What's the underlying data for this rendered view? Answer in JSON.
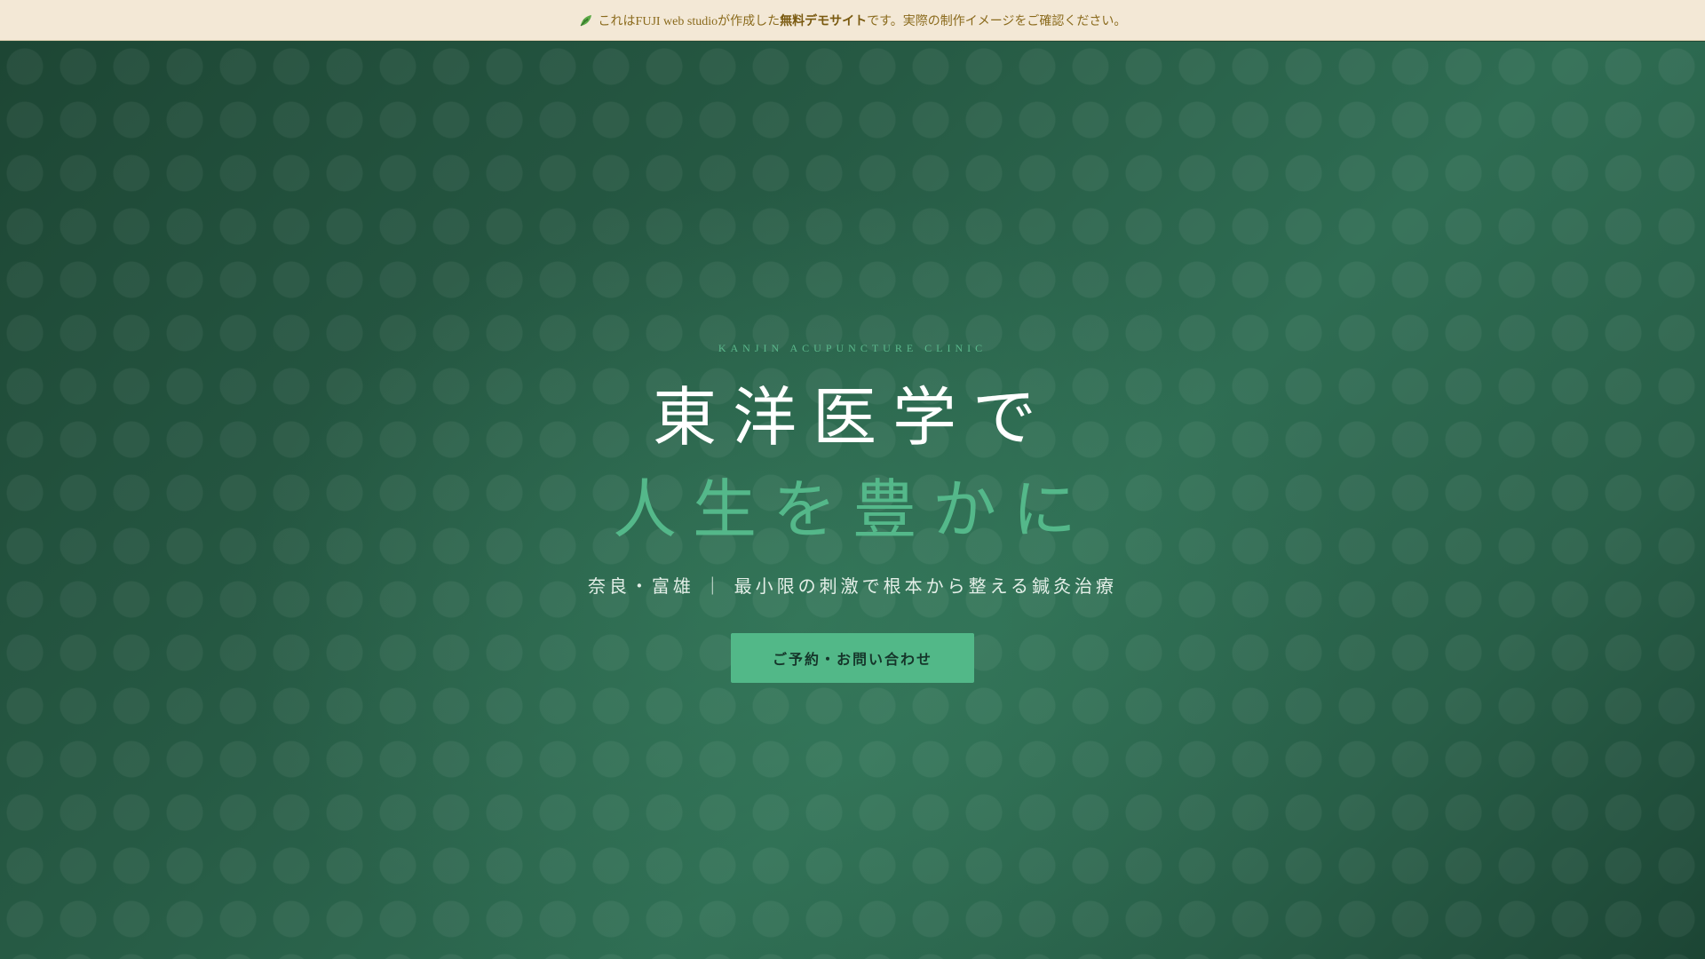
{
  "banner": {
    "icon": "leaf-icon",
    "text_before": "これはFUJI web studioが作成した",
    "text_strong": "無料デモサイト",
    "text_after": "です。実際の制作イメージをご確認ください。",
    "bg_color": "#f3e8d6",
    "text_color": "#8a6a1c"
  },
  "hero": {
    "eyebrow": "KANJIN ACUPUNCTURE CLINIC",
    "title_line_1": "東洋医学で",
    "title_line_2": "人生を豊かに",
    "subtitle": "奈良・富雄 ｜ 最小限の刺激で根本から整える鍼灸治療",
    "cta_label": "ご予約・お問い合わせ",
    "bg_color": "#265a44",
    "accent_color": "#54b88a"
  }
}
